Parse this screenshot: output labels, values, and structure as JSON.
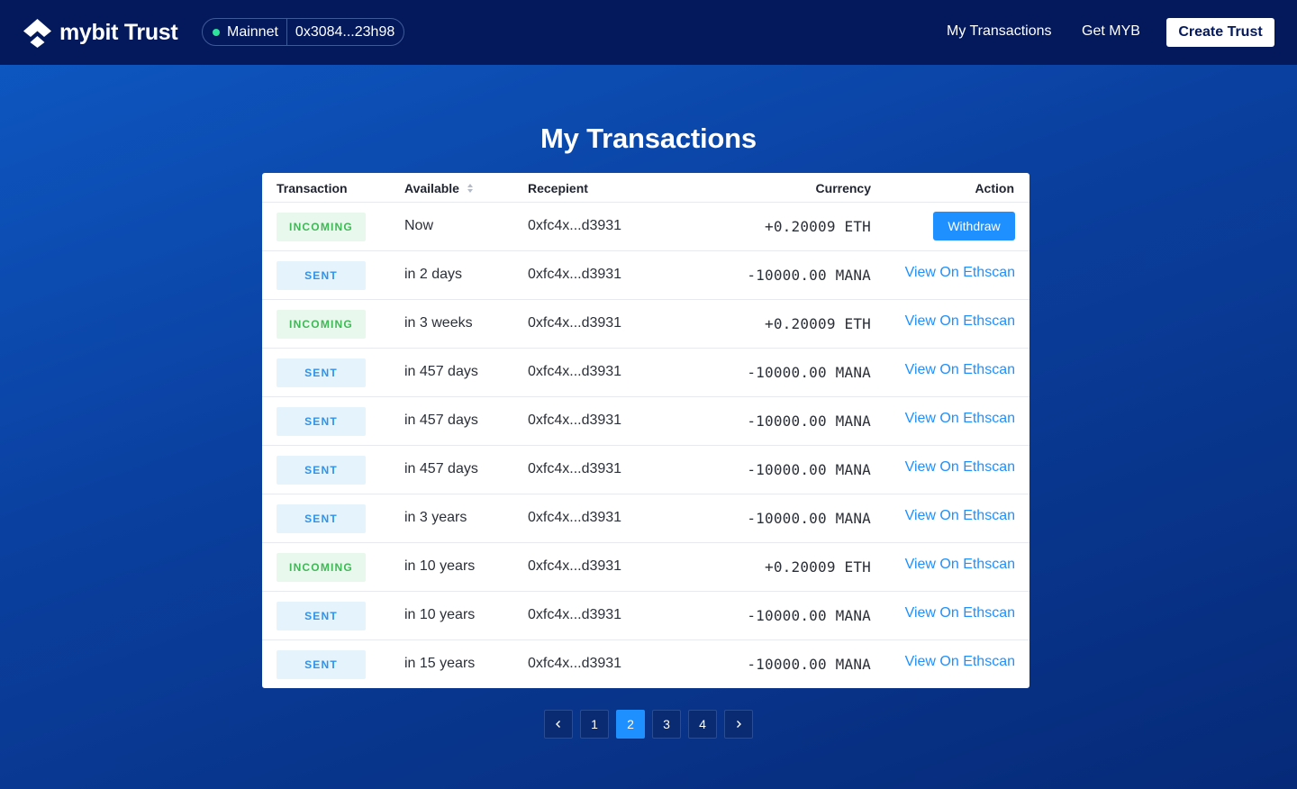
{
  "header": {
    "logo_text": "mybit Trust",
    "network": {
      "name": "Mainnet",
      "address": "0x3084...23h98",
      "status_color": "#2ee39a"
    },
    "nav": {
      "transactions": "My Transactions",
      "get_myb": "Get MYB"
    },
    "create_trust_label": "Create Trust"
  },
  "page_title": "My Transactions",
  "table": {
    "columns": {
      "transaction": "Transaction",
      "available": "Available",
      "recipient": "Recepient",
      "currency": "Currency",
      "action": "Action"
    },
    "rows": [
      {
        "type": "INCOMING",
        "kind": "incoming",
        "available": "Now",
        "recipient": "0xfc4x...d3931",
        "currency": "+0.20009 ETH",
        "action": "Withdraw"
      },
      {
        "type": "SENT",
        "kind": "sent",
        "available": "in 2 days",
        "recipient": "0xfc4x...d3931",
        "currency": "-10000.00 MANA",
        "action": "View On Ethscan"
      },
      {
        "type": "INCOMING",
        "kind": "incoming",
        "available": "in 3 weeks",
        "recipient": "0xfc4x...d3931",
        "currency": "+0.20009 ETH",
        "action": "View On Ethscan"
      },
      {
        "type": "SENT",
        "kind": "sent",
        "available": "in 457 days",
        "recipient": "0xfc4x...d3931",
        "currency": "-10000.00 MANA",
        "action": "View On Ethscan"
      },
      {
        "type": "SENT",
        "kind": "sent",
        "available": "in 457 days",
        "recipient": "0xfc4x...d3931",
        "currency": "-10000.00 MANA",
        "action": "View On Ethscan"
      },
      {
        "type": "SENT",
        "kind": "sent",
        "available": "in 457 days",
        "recipient": "0xfc4x...d3931",
        "currency": "-10000.00 MANA",
        "action": "View On Ethscan"
      },
      {
        "type": "SENT",
        "kind": "sent",
        "available": "in 3 years",
        "recipient": "0xfc4x...d3931",
        "currency": "-10000.00 MANA",
        "action": "View On Ethscan"
      },
      {
        "type": "INCOMING",
        "kind": "incoming",
        "available": "in 10 years",
        "recipient": "0xfc4x...d3931",
        "currency": "+0.20009 ETH",
        "action": "View On Ethscan"
      },
      {
        "type": "SENT",
        "kind": "sent",
        "available": "in 10 years",
        "recipient": "0xfc4x...d3931",
        "currency": "-10000.00 MANA",
        "action": "View On Ethscan"
      },
      {
        "type": "SENT",
        "kind": "sent",
        "available": "in 15 years",
        "recipient": "0xfc4x...d3931",
        "currency": "-10000.00 MANA",
        "action": "View On Ethscan"
      }
    ]
  },
  "pagination": {
    "pages": [
      "1",
      "2",
      "3",
      "4"
    ],
    "current": "2"
  },
  "colors": {
    "header_bg": "#04195b",
    "accent": "#1e90ff",
    "incoming": "#3fb856",
    "sent": "#2f93ec"
  }
}
